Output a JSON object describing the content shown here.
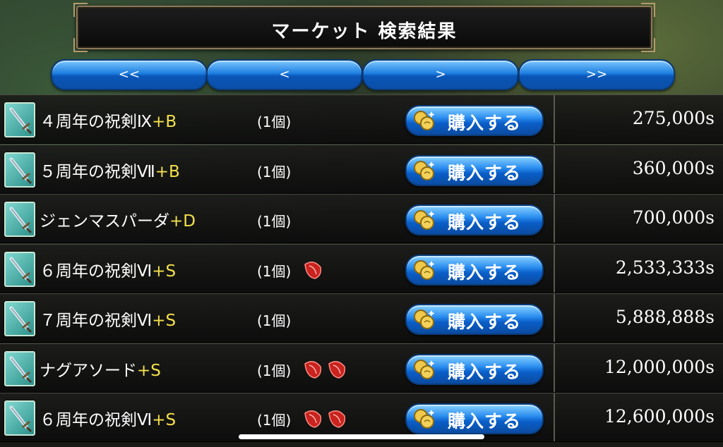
{
  "title": "マーケット 検索結果",
  "nav": {
    "first": "<<",
    "prev": "<",
    "next": ">",
    "last": ">>"
  },
  "buy_label": "購入する",
  "rows": [
    {
      "name": "４周年の祝剣Ⅸ",
      "grade": "+B",
      "qty": "(1個)",
      "runes": 0,
      "price": "275,000s"
    },
    {
      "name": "５周年の祝剣Ⅶ",
      "grade": "+B",
      "qty": "(1個)",
      "runes": 0,
      "price": "360,000s"
    },
    {
      "name": "ジェンマスパーダ",
      "grade": "+D",
      "qty": "(1個)",
      "runes": 0,
      "price": "700,000s"
    },
    {
      "name": "６周年の祝剣Ⅵ",
      "grade": "+S",
      "qty": "(1個)",
      "runes": 1,
      "price": "2,533,333s"
    },
    {
      "name": "７周年の祝剣Ⅵ",
      "grade": "+S",
      "qty": "(1個)",
      "runes": 0,
      "price": "5,888,888s"
    },
    {
      "name": "ナグアソード",
      "grade": "+S",
      "qty": "(1個)",
      "runes": 2,
      "price": "12,000,000s"
    },
    {
      "name": "６周年の祝剣Ⅵ",
      "grade": "+S",
      "qty": "(1個)",
      "runes": 2,
      "price": "12,600,000s"
    }
  ],
  "icons": {
    "item": "sword-icon",
    "rune": "red-rune-icon",
    "coin": "coin-icon"
  },
  "colors": {
    "grade": "#f4e04a",
    "button": "#1e7fe0"
  }
}
